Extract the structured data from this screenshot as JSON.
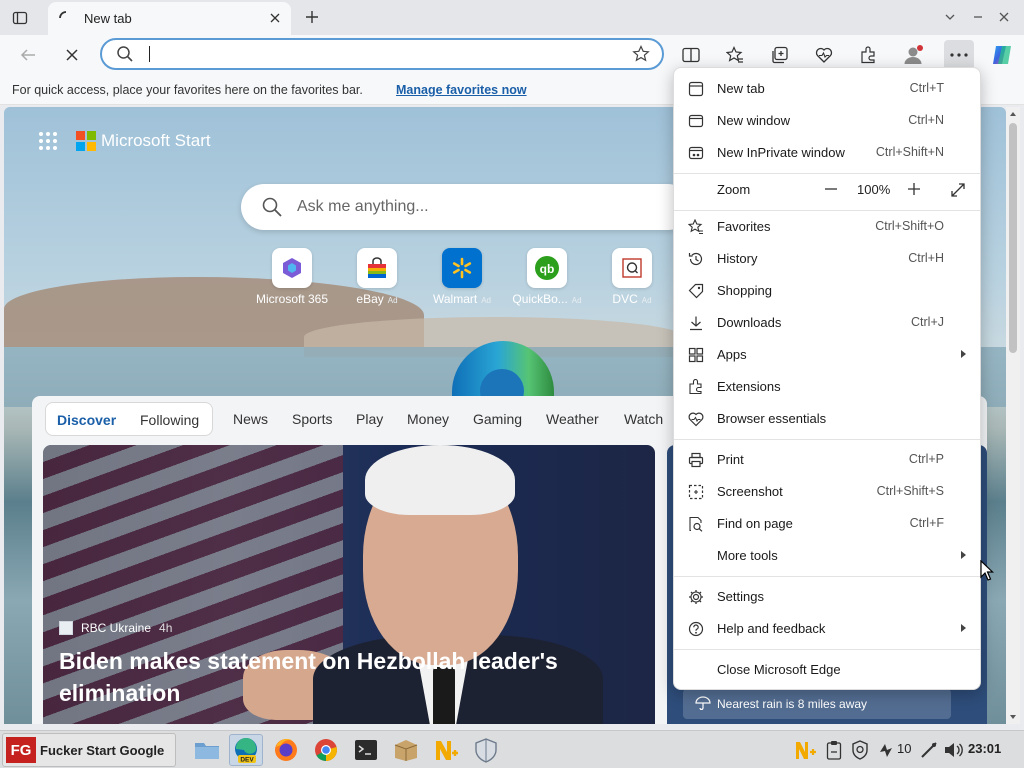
{
  "tab": {
    "title": "New tab"
  },
  "favbar": {
    "message": "For quick access, place your favorites here on the favorites bar.",
    "link": "Manage favorites now"
  },
  "newtab": {
    "brand": "Microsoft Start",
    "search_placeholder": "Ask me anything...",
    "quick_links": [
      {
        "label": "Microsoft 365",
        "ad": ""
      },
      {
        "label": "eBay",
        "ad": "Ad"
      },
      {
        "label": "Walmart",
        "ad": "Ad"
      },
      {
        "label": "QuickBo...",
        "ad": "Ad"
      },
      {
        "label": "DVC",
        "ad": "Ad"
      }
    ],
    "feed_pill": {
      "discover": "Discover",
      "following": "Following"
    },
    "feed_nav": [
      "News",
      "Sports",
      "Play",
      "Money",
      "Gaming",
      "Weather",
      "Watch"
    ],
    "hero": {
      "source": "RBC Ukraine",
      "time": "4h",
      "headline": "Biden makes statement on Hezbollah leader's elimination"
    },
    "weather_note": "Nearest rain is 8 miles away"
  },
  "menu": {
    "items": [
      {
        "label": "New tab",
        "shortcut": "Ctrl+T"
      },
      {
        "label": "New window",
        "shortcut": "Ctrl+N"
      },
      {
        "label": "New InPrivate window",
        "shortcut": "Ctrl+Shift+N"
      },
      {
        "label": "Zoom",
        "shortcut": ""
      },
      {
        "label": "Favorites",
        "shortcut": "Ctrl+Shift+O"
      },
      {
        "label": "History",
        "shortcut": "Ctrl+H"
      },
      {
        "label": "Shopping",
        "shortcut": ""
      },
      {
        "label": "Downloads",
        "shortcut": "Ctrl+J"
      },
      {
        "label": "Apps",
        "shortcut": ""
      },
      {
        "label": "Extensions",
        "shortcut": ""
      },
      {
        "label": "Browser essentials",
        "shortcut": ""
      },
      {
        "label": "Print",
        "shortcut": "Ctrl+P"
      },
      {
        "label": "Screenshot",
        "shortcut": "Ctrl+Shift+S"
      },
      {
        "label": "Find on page",
        "shortcut": "Ctrl+F"
      },
      {
        "label": "More tools",
        "shortcut": ""
      },
      {
        "label": "Settings",
        "shortcut": ""
      },
      {
        "label": "Help and feedback",
        "shortcut": ""
      },
      {
        "label": "Close Microsoft Edge",
        "shortcut": ""
      }
    ],
    "zoom_value": "100%"
  },
  "taskbar": {
    "start_label": "Fucker Start Google",
    "start_logo": "FG",
    "edge_badge": "DEV",
    "tray_count": "10",
    "clock": "23:01"
  },
  "colors": {
    "accent": "#1a5fa8",
    "address_border": "#5b9bd5",
    "start_red": "#c4211f"
  }
}
